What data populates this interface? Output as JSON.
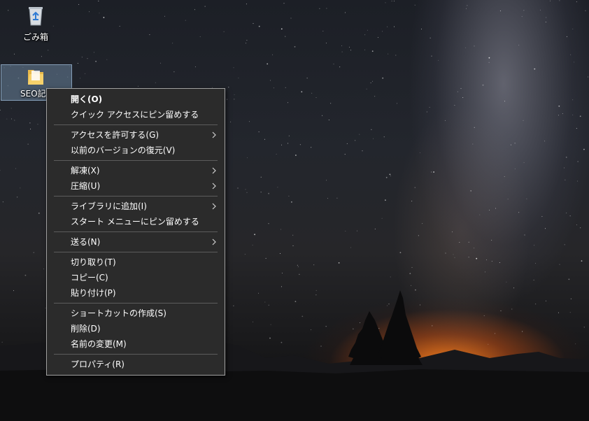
{
  "desktop": {
    "icons": [
      {
        "name": "recycle-bin",
        "label": "ごみ箱"
      },
      {
        "name": "folder",
        "label": "SEO記事"
      }
    ]
  },
  "context_menu": {
    "groups": [
      [
        {
          "label": "開く(O)",
          "bold": true,
          "submenu": false
        },
        {
          "label": "クイック アクセスにピン留めする",
          "bold": false,
          "submenu": false
        }
      ],
      [
        {
          "label": "アクセスを許可する(G)",
          "bold": false,
          "submenu": true
        },
        {
          "label": "以前のバージョンの復元(V)",
          "bold": false,
          "submenu": false
        }
      ],
      [
        {
          "label": "解凍(X)",
          "bold": false,
          "submenu": true
        },
        {
          "label": "圧縮(U)",
          "bold": false,
          "submenu": true
        }
      ],
      [
        {
          "label": "ライブラリに追加(I)",
          "bold": false,
          "submenu": true
        },
        {
          "label": "スタート メニューにピン留めする",
          "bold": false,
          "submenu": false
        }
      ],
      [
        {
          "label": "送る(N)",
          "bold": false,
          "submenu": true
        }
      ],
      [
        {
          "label": "切り取り(T)",
          "bold": false,
          "submenu": false
        },
        {
          "label": "コピー(C)",
          "bold": false,
          "submenu": false
        },
        {
          "label": "貼り付け(P)",
          "bold": false,
          "submenu": false
        }
      ],
      [
        {
          "label": "ショートカットの作成(S)",
          "bold": false,
          "submenu": false
        },
        {
          "label": "削除(D)",
          "bold": false,
          "submenu": false
        },
        {
          "label": "名前の変更(M)",
          "bold": false,
          "submenu": false
        }
      ],
      [
        {
          "label": "プロパティ(R)",
          "bold": false,
          "submenu": false
        }
      ]
    ]
  },
  "colors": {
    "menu_background": "#2b2b2b",
    "menu_border": "#a0a0a0",
    "separator": "#5c5c5c",
    "selection_highlight": "#7896b4"
  }
}
